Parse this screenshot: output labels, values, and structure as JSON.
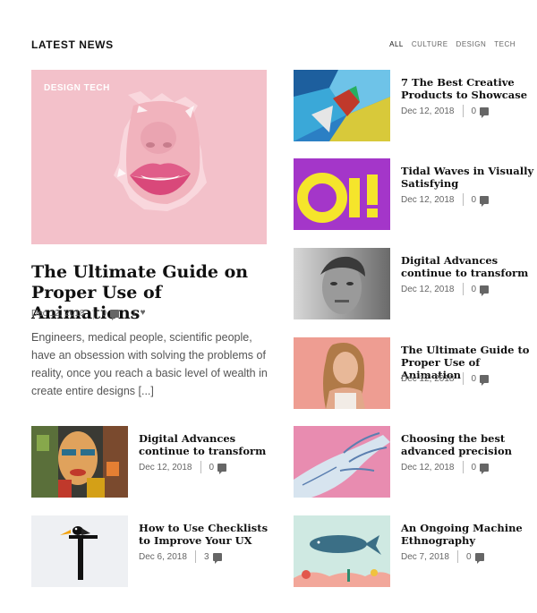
{
  "header": {
    "title": "LATEST NEWS",
    "filters": [
      "ALL",
      "CULTURE",
      "DESIGN",
      "TECH"
    ]
  },
  "featured": {
    "category": "DESIGN TECH",
    "title": "The Ultimate Guide on Proper Use of Animations",
    "date": "Dec 12, 2018",
    "comments": "0",
    "likes": "1",
    "excerpt": "Engineers, medical people, scientific people, have an obsession with solving the problems of reality, once you reach a basic level of wealth in create entire designs [...]"
  },
  "left_posts": [
    {
      "title": "Digital Advances continue to transform",
      "date": "Dec 12, 2018",
      "comments": "0"
    },
    {
      "title": "How to Use Checklists to Improve Your UX",
      "date": "Dec 6, 2018",
      "comments": "3"
    }
  ],
  "right_posts": [
    {
      "title": "7 The Best Creative Products to Showcase",
      "date": "Dec 12, 2018",
      "comments": "0"
    },
    {
      "title": "Tidal Waves in Visually Satisfying",
      "date": "Dec 12, 2018",
      "comments": "0"
    },
    {
      "title": "Digital Advances continue to transform",
      "date": "Dec 12, 2018",
      "comments": "0"
    },
    {
      "title": "The Ultimate Guide to Proper Use of Animation",
      "date": "Dec 12, 2018",
      "comments": "0"
    },
    {
      "title": "Choosing the best advanced precision",
      "date": "Dec 12, 2018",
      "comments": "0"
    },
    {
      "title": "An Ongoing Machine Ethnography",
      "date": "Dec 7, 2018",
      "comments": "0"
    }
  ],
  "thumbnail_text": {
    "oi": "OI!"
  }
}
